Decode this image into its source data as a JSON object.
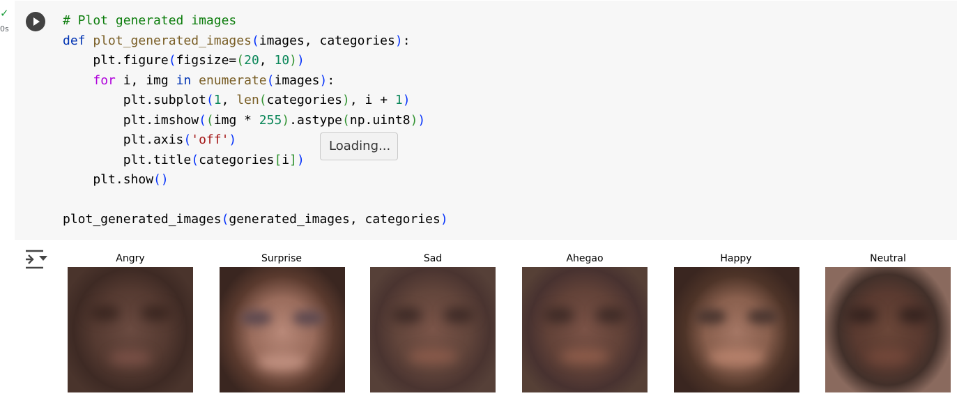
{
  "cell": {
    "status_icon": "check-icon",
    "exec_time": "0s",
    "code_lines": [
      "# Plot generated images",
      "def plot_generated_images(images, categories):",
      "    plt.figure(figsize=(20, 10))",
      "    for i, img in enumerate(images):",
      "        plt.subplot(1, len(categories), i + 1)",
      "        plt.imshow((img * 255).astype(np.uint8))",
      "        plt.axis('off')",
      "        plt.title(categories[i])",
      "    plt.show()",
      "",
      "plot_generated_images(generated_images, categories)"
    ]
  },
  "tooltip": {
    "text": "Loading..."
  },
  "output": {
    "icon": "output-toggle-icon",
    "titles": [
      "Angry",
      "Surprise",
      "Sad",
      "Ahegao",
      "Happy",
      "Neutral"
    ]
  },
  "colors": {
    "cell_bg": "#f7f7f7",
    "comment": "#0d7d0d",
    "keyword": "#0033b3",
    "function": "#795e26",
    "string": "#a31515",
    "number": "#098658"
  }
}
